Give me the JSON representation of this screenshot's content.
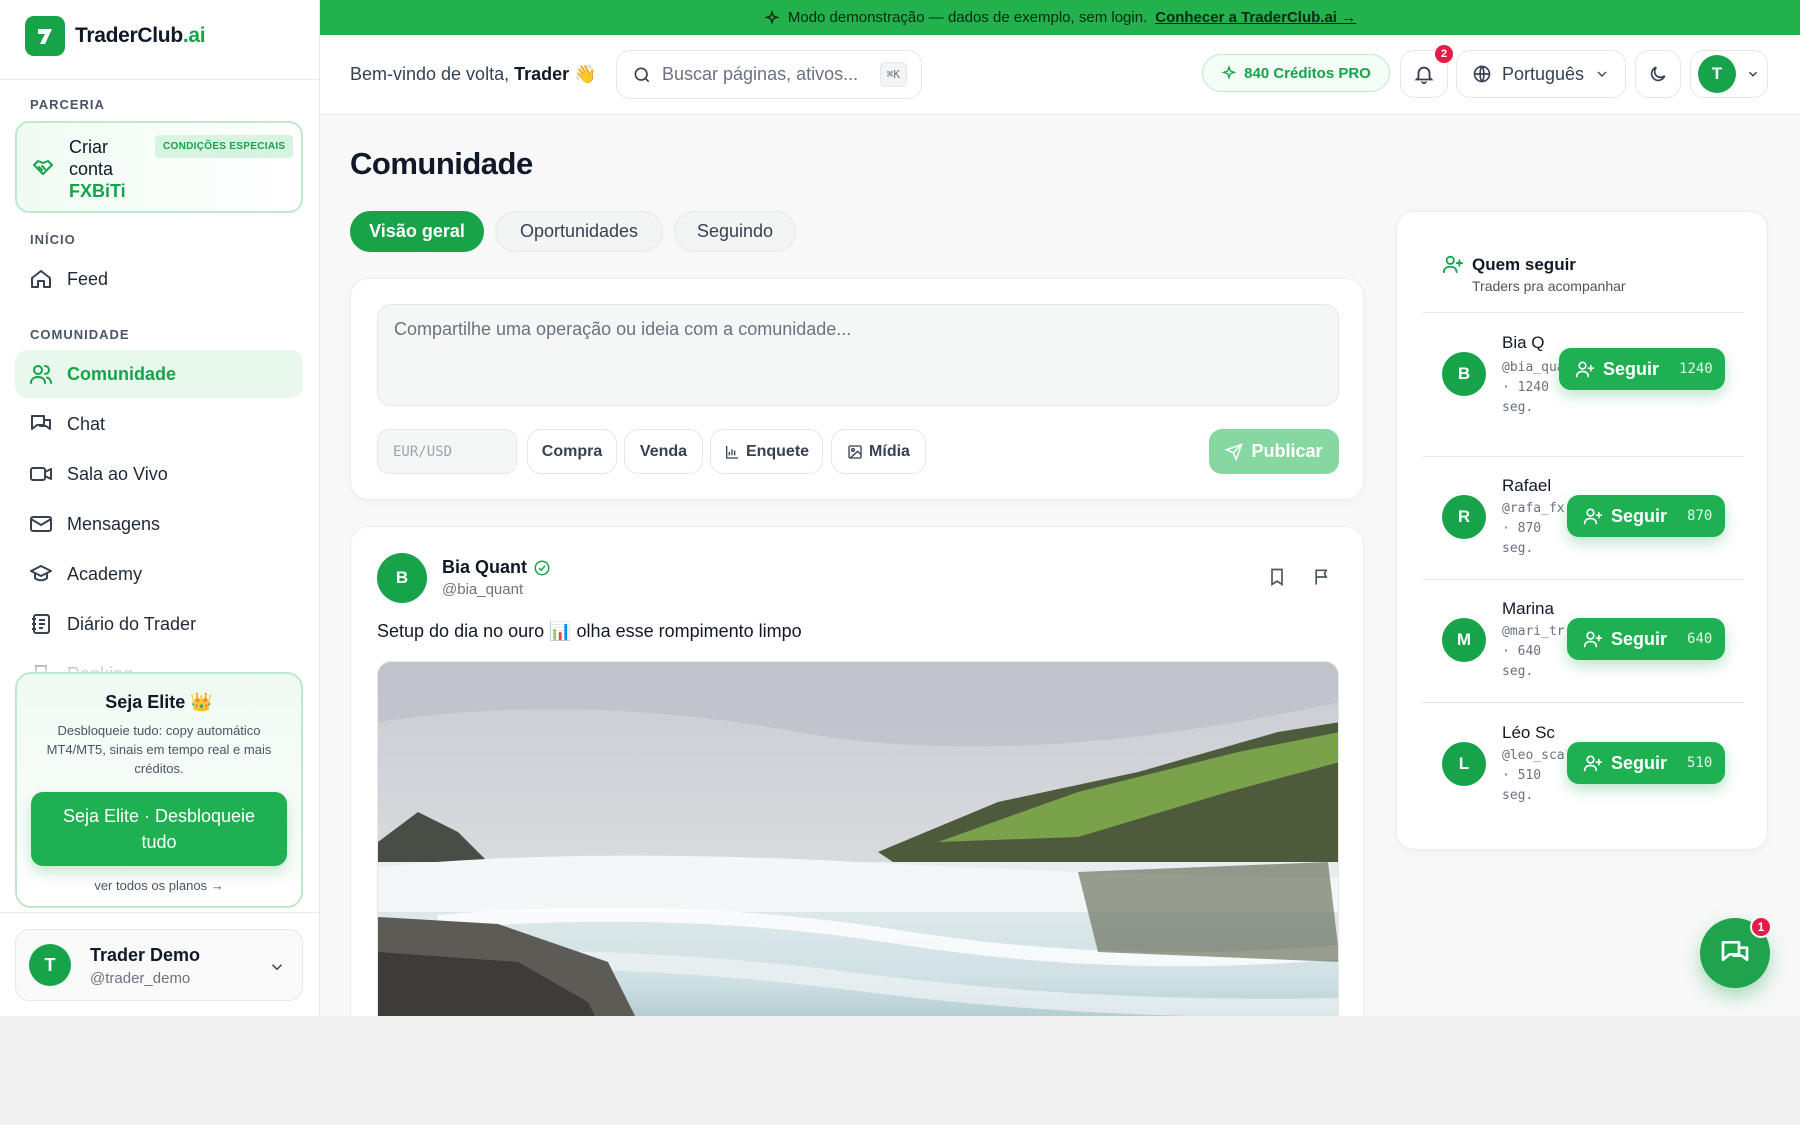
{
  "brand": {
    "name": "TraderClub",
    "suffix": ".ai"
  },
  "banner": {
    "text": "Modo demonstração — dados de exemplo, sem login.",
    "link": "Conhecer a TraderClub.ai →"
  },
  "sidebar": {
    "section_partner": "PARCERIA",
    "partner": {
      "line1": "Criar",
      "line2": "conta",
      "highlight": "FXBiTi",
      "badge": "CONDIÇÕES ESPECIAIS"
    },
    "section_home": "INÍCIO",
    "section_community": "COMUNIDADE",
    "items": [
      {
        "label": "Feed",
        "icon": "home-icon"
      },
      {
        "label": "Comunidade",
        "icon": "users-icon",
        "active": true
      },
      {
        "label": "Chat",
        "icon": "chat-icon"
      },
      {
        "label": "Sala ao Vivo",
        "icon": "video-icon"
      },
      {
        "label": "Mensagens",
        "icon": "mail-icon"
      },
      {
        "label": "Academy",
        "icon": "graduation-cap-icon"
      },
      {
        "label": "Diário do Trader",
        "icon": "notebook-icon"
      },
      {
        "label": "Ranking",
        "icon": "trophy-icon"
      }
    ],
    "elite": {
      "title": "Seja Elite 👑",
      "desc": "Desbloqueie tudo: copy automático MT4/MT5, sinais em tempo real e mais créditos.",
      "button": "Seja Elite · Desbloqueie tudo",
      "link": "ver todos os planos →"
    },
    "user": {
      "initial": "T",
      "name": "Trader Demo",
      "handle": "@trader_demo"
    }
  },
  "header": {
    "welcome_prefix": "Bem-vindo de volta,",
    "welcome_name": "Trader 👋",
    "search_placeholder": "Buscar páginas, ativos...",
    "search_kbd": "⌘K",
    "credits": "840 Créditos PRO",
    "notifications": "2",
    "language": "Português",
    "avatar": "T"
  },
  "main": {
    "title": "Comunidade",
    "tabs": [
      {
        "label": "Visão geral",
        "active": true
      },
      {
        "label": "Oportunidades"
      },
      {
        "label": "Seguindo"
      }
    ],
    "composer": {
      "placeholder": "Compartilhe uma operação ou ideia com a comunidade...",
      "pair_placeholder": "EUR/USD",
      "buy": "Compra",
      "sell": "Venda",
      "poll": "Enquete",
      "media": "Mídia",
      "publish": "Publicar"
    },
    "post": {
      "initial": "B",
      "name": "Bia Quant",
      "handle": "@bia_quant",
      "text": "Setup do dia no ouro 📊 olha esse rompimento limpo"
    }
  },
  "who_to_follow": {
    "title": "Quem seguir",
    "subtitle": "Traders pra acompanhar",
    "button": "Seguir",
    "users": [
      {
        "initial": "B",
        "name": "Bia Q",
        "handle": "@bia_quant",
        "followers": "1240",
        "meta": "· 1240 seg."
      },
      {
        "initial": "R",
        "name": "Rafael",
        "handle": "@rafa_fx",
        "followers": "870",
        "meta": "· 870 seg."
      },
      {
        "initial": "M",
        "name": "Marina",
        "handle": "@mari_tr",
        "followers": "640",
        "meta": "· 640 seg."
      },
      {
        "initial": "L",
        "name": "Léo Sc",
        "handle": "@leo_scalp",
        "followers": "510",
        "meta": "· 510 seg."
      }
    ]
  },
  "chat_fab": {
    "badge": "1"
  },
  "colors": {
    "accent": "#16a34a",
    "banner": "#22b14c",
    "badge": "#e11d48"
  }
}
